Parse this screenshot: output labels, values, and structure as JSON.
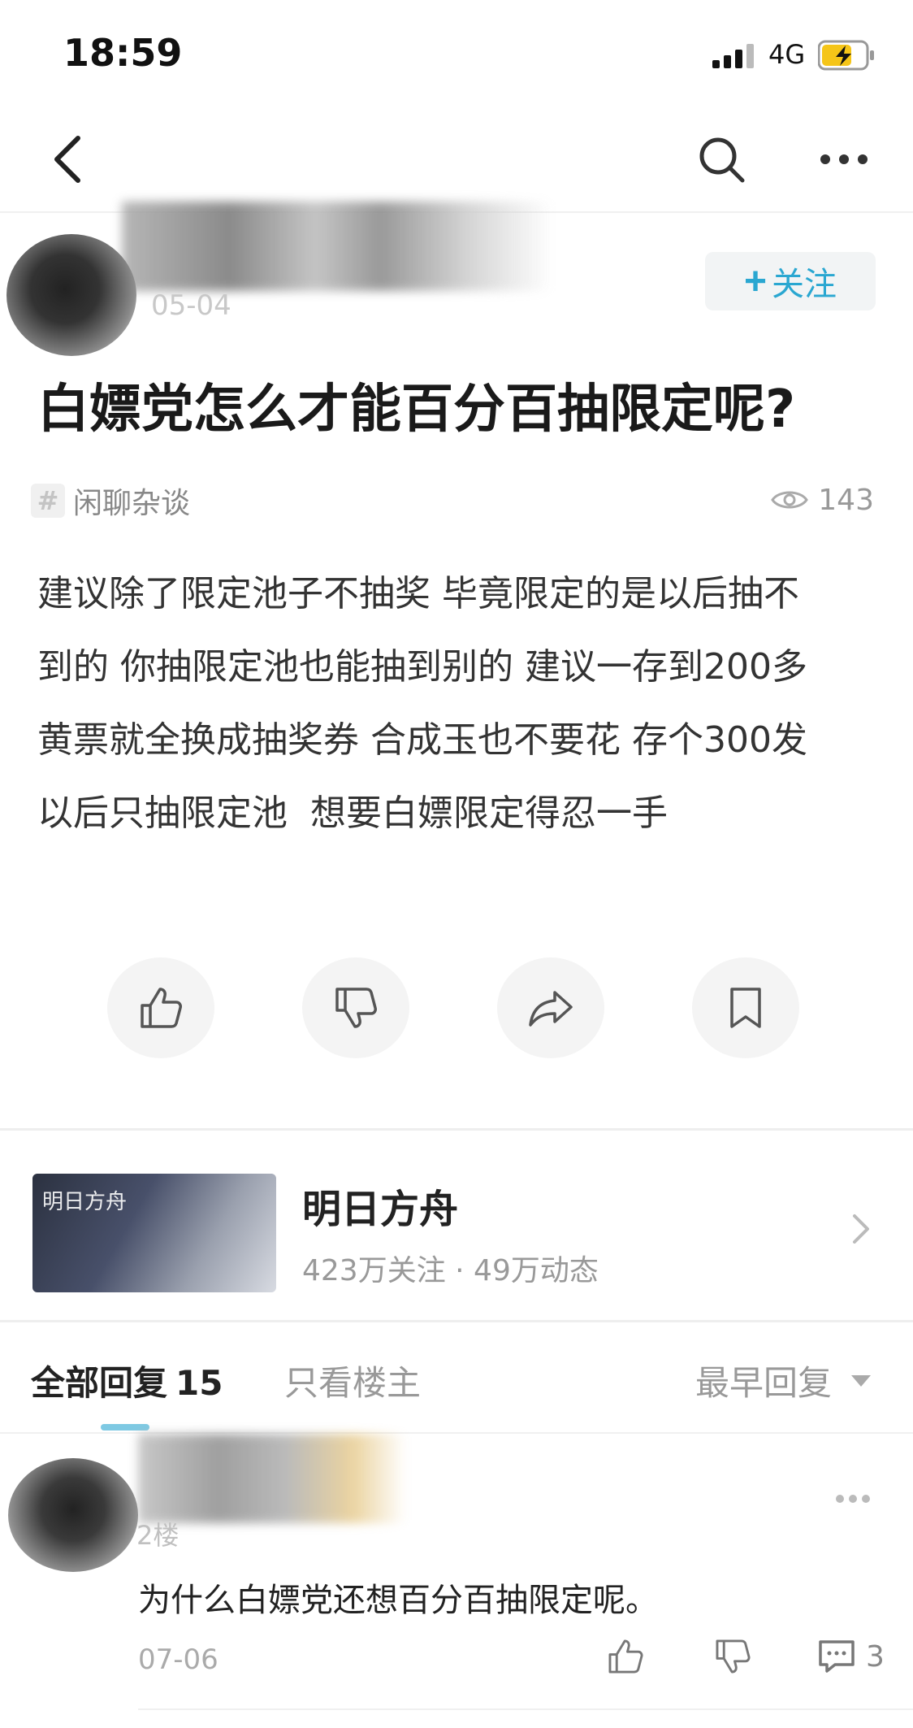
{
  "status_bar": {
    "time": "18:59",
    "network": "4G"
  },
  "nav": {
    "back_icon": "back-chevron-icon",
    "search_icon": "search-icon",
    "more_icon": "more-dots-icon"
  },
  "author": {
    "date": "05-04",
    "follow_label": "关注",
    "follow_plus": "+"
  },
  "post": {
    "title": "白嫖党怎么才能百分百抽限定呢?",
    "topic_hash": "#",
    "topic": "闲聊杂谈",
    "views": "143",
    "body": "建议除了限定池子不抽奖 毕竟限定的是以后抽不\n到的 你抽限定池也能抽到别的 建议一存到200多\n黄票就全换成抽奖券 合成玉也不要花 存个300发\n以后只抽限定池  想要白嫖限定得忍一手"
  },
  "actions": [
    "like",
    "dislike",
    "share",
    "bookmark"
  ],
  "game": {
    "logo_text": "明日方舟",
    "name": "明日方舟",
    "stats": "423万关注 · 49万动态"
  },
  "replies_header": {
    "tab_all": "全部回复",
    "tab_all_count": "15",
    "tab_op": "只看楼主",
    "sort": "最早回复"
  },
  "reply": {
    "floor": "2楼",
    "text": "为什么白嫖党还想百分百抽限定呢。",
    "date": "07-06",
    "comment_count": "3"
  },
  "colors": {
    "accent": "#2aa7d1",
    "tab_indicator": "#7ec9e3",
    "battery": "#f5c518"
  }
}
